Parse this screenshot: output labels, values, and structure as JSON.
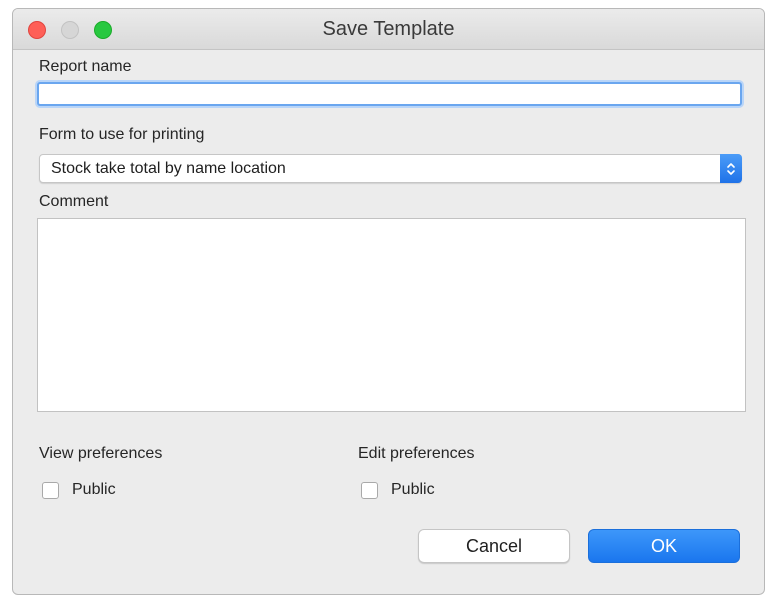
{
  "window": {
    "title": "Save Template"
  },
  "form": {
    "report_name_label": "Report name",
    "report_name_value": "",
    "print_form_label": "Form to use for printing",
    "print_form_selected": "Stock take total by name location",
    "comment_label": "Comment",
    "comment_value": ""
  },
  "preferences": {
    "view_label": "View preferences",
    "view_public_label": "Public",
    "view_public_checked": false,
    "edit_label": "Edit preferences",
    "edit_public_label": "Public",
    "edit_public_checked": false
  },
  "buttons": {
    "cancel_label": "Cancel",
    "ok_label": "OK"
  },
  "icons": {
    "select_arrow": "updown-chevron-icon",
    "close": "close-window-icon",
    "minimize": "minimize-window-icon",
    "maximize": "maximize-window-icon"
  },
  "colors": {
    "accent": "#1f76ee",
    "focus_ring": "#6aa6ef",
    "close": "#fe5f57",
    "maximize": "#28c840"
  }
}
